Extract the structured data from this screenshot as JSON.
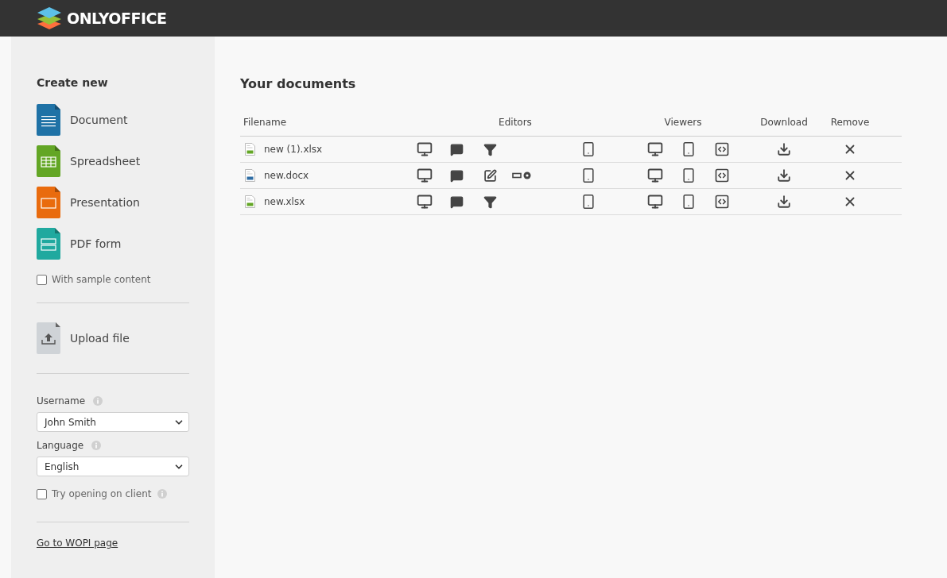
{
  "header": {
    "brand": "ONLYOFFICE"
  },
  "sidebar": {
    "create_title": "Create new",
    "create_items": [
      {
        "kind": "document",
        "label": "Document"
      },
      {
        "kind": "spreadsheet",
        "label": "Spreadsheet"
      },
      {
        "kind": "presentation",
        "label": "Presentation"
      },
      {
        "kind": "pdfform",
        "label": "PDF form"
      }
    ],
    "sample_content": {
      "label": "With sample content",
      "checked": false
    },
    "upload": {
      "label": "Upload file"
    },
    "username": {
      "label": "Username",
      "value": "John Smith"
    },
    "language": {
      "label": "Language",
      "value": "English"
    },
    "client": {
      "label": "Try opening on client",
      "checked": false
    },
    "wopi_link": "Go to WOPI page"
  },
  "documents": {
    "title": "Your documents",
    "columns": [
      "Filename",
      "Editors",
      "Viewers",
      "Download",
      "Remove"
    ],
    "rows": [
      {
        "name": "new (1).xlsx",
        "kind": "spreadsheet",
        "editors": [
          {
            "kind": "desktop"
          },
          {
            "kind": "comment"
          },
          {
            "kind": "filter"
          },
          {
            "kind": "mobile"
          }
        ],
        "viewers": [
          {
            "kind": "desktop"
          },
          {
            "kind": "mobile"
          },
          {
            "kind": "embed"
          }
        ]
      },
      {
        "name": "new.docx",
        "kind": "document",
        "editors": [
          {
            "kind": "desktop"
          },
          {
            "kind": "comment"
          },
          {
            "kind": "review"
          },
          {
            "kind": "fillform"
          },
          {
            "kind": "mobile"
          }
        ],
        "viewers": [
          {
            "kind": "desktop"
          },
          {
            "kind": "mobile"
          },
          {
            "kind": "embed"
          }
        ]
      },
      {
        "name": "new.xlsx",
        "kind": "spreadsheet",
        "editors": [
          {
            "kind": "desktop"
          },
          {
            "kind": "comment"
          },
          {
            "kind": "filter"
          },
          {
            "kind": "mobile"
          }
        ],
        "viewers": [
          {
            "kind": "desktop"
          },
          {
            "kind": "mobile"
          },
          {
            "kind": "embed"
          }
        ]
      }
    ]
  }
}
